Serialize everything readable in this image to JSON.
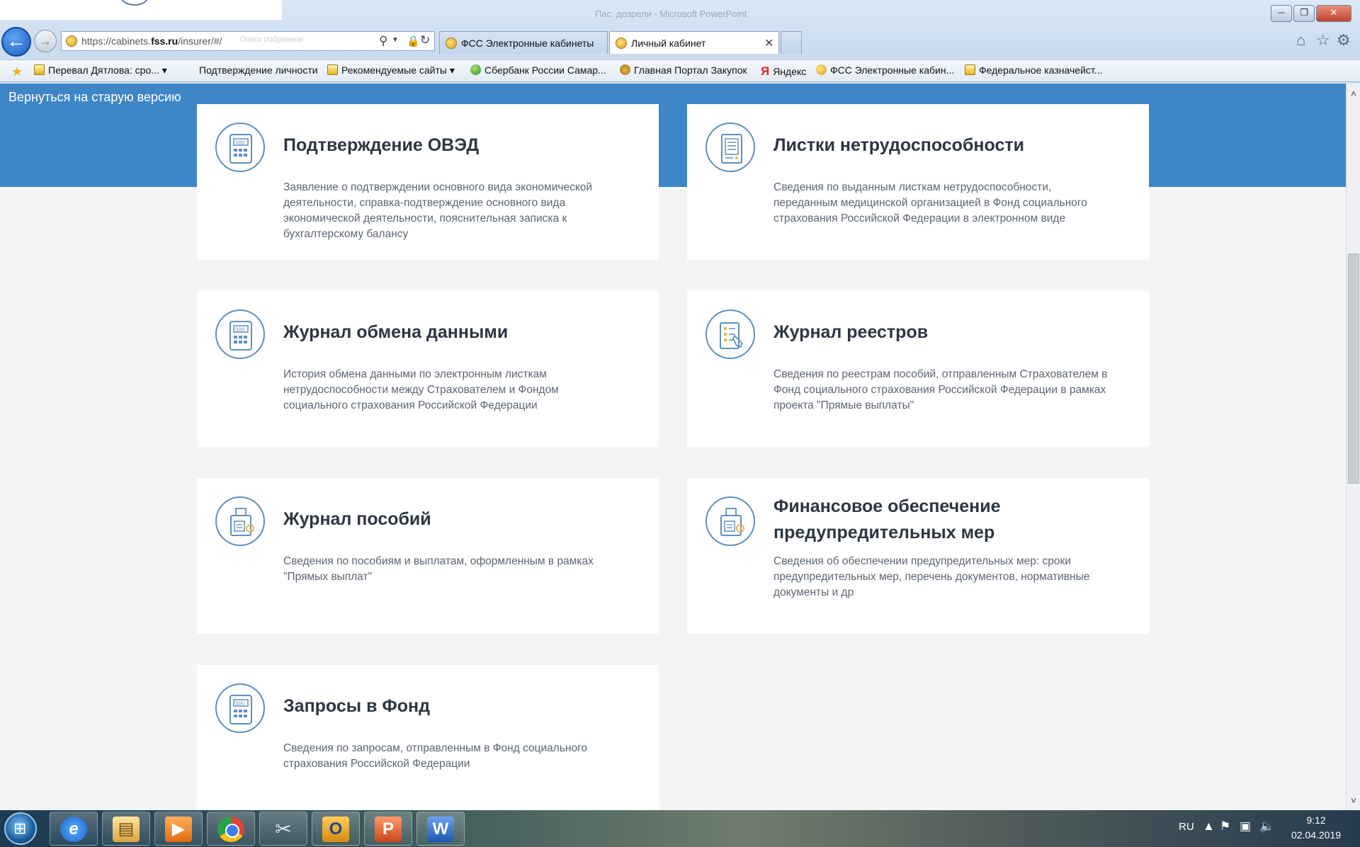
{
  "window": {
    "title": "Пас. дозрели - Microsoft PowerPoint",
    "minimize_glyph": "─",
    "maximize_glyph": "❐",
    "close_glyph": "✕"
  },
  "browser": {
    "address": {
      "url_prefix": "https://cabinets.",
      "url_domain": "fss.ru",
      "url_path": "/insurer/#/",
      "ghost_text": "Поиск    Избранное"
    },
    "tabs": [
      {
        "label": "ФСС Электронные кабинеты",
        "active": false
      },
      {
        "label": "Личный кабинет",
        "active": true
      }
    ],
    "favorites": [
      {
        "label": "Перевал Дятлова: сро...",
        "icon": "ie-doc-icon",
        "has_dropdown": true
      },
      {
        "label": "Подтверждение личности",
        "icon": "",
        "has_dropdown": false
      },
      {
        "label": "Рекомендуемые сайты",
        "icon": "ie-doc-icon",
        "has_dropdown": true
      },
      {
        "label": "Сбербанк России Самар...",
        "icon": "sberbank-icon",
        "has_dropdown": false
      },
      {
        "label": "Главная Портал Закупок",
        "icon": "eagle-icon",
        "has_dropdown": false
      },
      {
        "label": "Яндекс",
        "icon": "yandex-icon",
        "has_dropdown": false
      },
      {
        "label": "ФСС Электронные кабин...",
        "icon": "fss-icon",
        "has_dropdown": false
      },
      {
        "label": "Федеральное казначейст...",
        "icon": "ie-doc-icon",
        "has_dropdown": false
      }
    ]
  },
  "page": {
    "back_link": "Вернуться на старую версию",
    "cards": [
      {
        "title": "Подтверждение ОВЭД",
        "description": "Заявление о подтверждении основного вида экономической деятельности, справка-подтверждение основного вида экономической деятельности, пояснительная записка к бухгалтерскому балансу",
        "icon": "calculator-document-icon"
      },
      {
        "title": "Листки нетрудоспособности",
        "description": "Сведения по выданным листкам нетрудоспособности, переданным медицинской организацией в Фонд социального страхования Российской Федерации в электронном виде",
        "icon": "sick-leave-document-icon"
      },
      {
        "title": "Журнал обмена данными",
        "description": "История обмена данными по электронным листкам нетрудоспособности между Страхователем и Фондом социального страхования Российской Федерации",
        "icon": "calculator-document-icon"
      },
      {
        "title": "Журнал реестров",
        "description": "Сведения по реестрам пособий, отправленным Страхователем в Фонд социального страхования Российской Федерации в рамках проекта \"Прямые выплаты\"",
        "icon": "registry-pen-icon"
      },
      {
        "title": "Журнал пособий",
        "description": "Сведения по пособиям и выплатам, оформленным в рамках \"Прямых выплат\"",
        "icon": "benefits-printer-icon"
      },
      {
        "title": "Финансовое обеспечение предупредительных мер",
        "description": "Сведения об обеспечении предупредительных мер: сроки предупредительных мер, перечень документов, нормативные документы и др",
        "icon": "finance-printer-icon"
      },
      {
        "title": "Запросы в Фонд",
        "description": "Сведения по запросам, отправленным в Фонд социального страхования Российской Федерации",
        "icon": "calculator-document-icon"
      }
    ]
  },
  "taskbar": {
    "apps": [
      "internet-explorer",
      "windows-explorer",
      "media-player",
      "google-chrome",
      "snipping-tool",
      "outlook",
      "powerpoint",
      "word"
    ],
    "app_glyphs": {
      "ie": "e",
      "explorer": "▤",
      "media": "▶",
      "snip": "✂",
      "outlook": "O",
      "ppt": "P",
      "word": "W"
    },
    "language": "RU",
    "time": "9:12",
    "date": "02.04.2019"
  },
  "colors": {
    "header_blue": "#3f86c6",
    "card_bg": "#ffffff",
    "icon_stroke": "#5f8fc0",
    "page_bg": "#f3f4f6"
  }
}
